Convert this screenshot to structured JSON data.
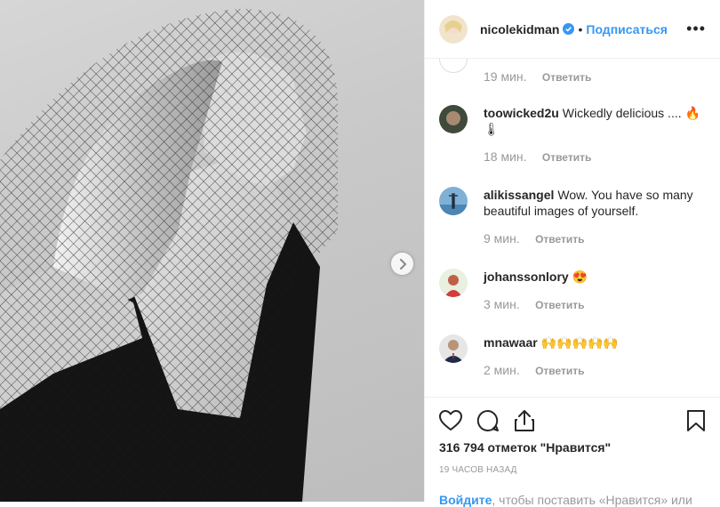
{
  "post": {
    "username": "nicolekidman",
    "dot": "•",
    "follow_label": "Подписаться",
    "more_label": "•••"
  },
  "comments": [
    {
      "username": "",
      "text": "",
      "time": "19 мин.",
      "reply": "Ответить"
    },
    {
      "username": "toowicked2u",
      "text": "Wickedly delicious .... 🔥 🌡",
      "time": "18 мин.",
      "reply": "Ответить"
    },
    {
      "username": "alikissangel",
      "text": "Wow. You have so many beautiful images of yourself.",
      "time": "9 мин.",
      "reply": "Ответить"
    },
    {
      "username": "johanssonlory",
      "text": "😍",
      "time": "3 мин.",
      "reply": "Ответить"
    },
    {
      "username": "mnawaar",
      "text": "🙌🙌🙌🙌🙌",
      "time": "2 мин.",
      "reply": "Ответить"
    }
  ],
  "actions": {
    "likes_text": "316 794 отметок \"Нравится\"",
    "posted_ago": "19 ЧАСОВ НАЗАД"
  },
  "login_prompt": {
    "link": "Войдите",
    "rest": ", чтобы поставить «Нравится» или"
  },
  "colors": {
    "accent": "#3897f0",
    "muted": "#999999",
    "text": "#262626"
  }
}
